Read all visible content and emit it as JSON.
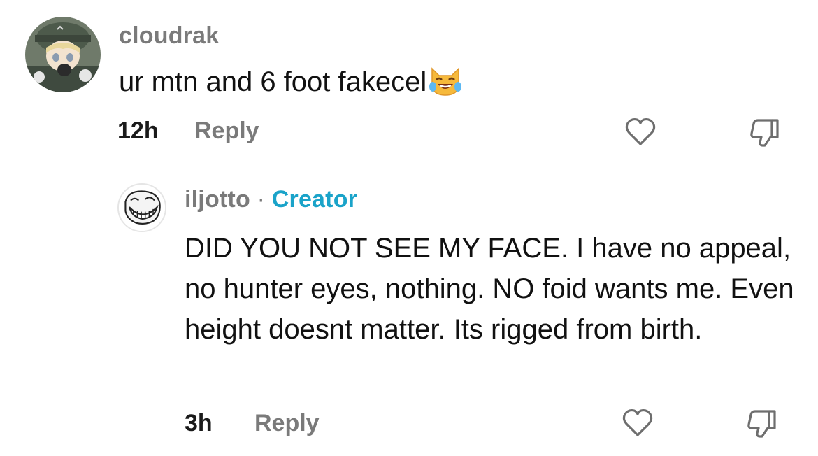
{
  "comments": [
    {
      "username": "cloudrak",
      "text": "ur mtn and 6 foot fakecel",
      "emoji_icon": "crying-laughing-cat-emoji",
      "time": "12h",
      "reply_label": "Reply",
      "like_icon": "heart-icon",
      "dislike_icon": "thumbs-down-icon"
    },
    {
      "username": "iljotto",
      "separator": "·",
      "badge": "Creator",
      "text": "DID YOU NOT SEE MY FACE. I have no appeal, no hunter eyes, nothing. NO foid wants me. Even height doesnt matter. Its rigged from birth.",
      "time": "3h",
      "reply_label": "Reply",
      "like_icon": "heart-icon",
      "dislike_icon": "thumbs-down-icon"
    }
  ],
  "colors": {
    "creator_badge": "#1aa3c9",
    "secondary_text": "#7a7a7a",
    "primary_text": "#111111"
  }
}
